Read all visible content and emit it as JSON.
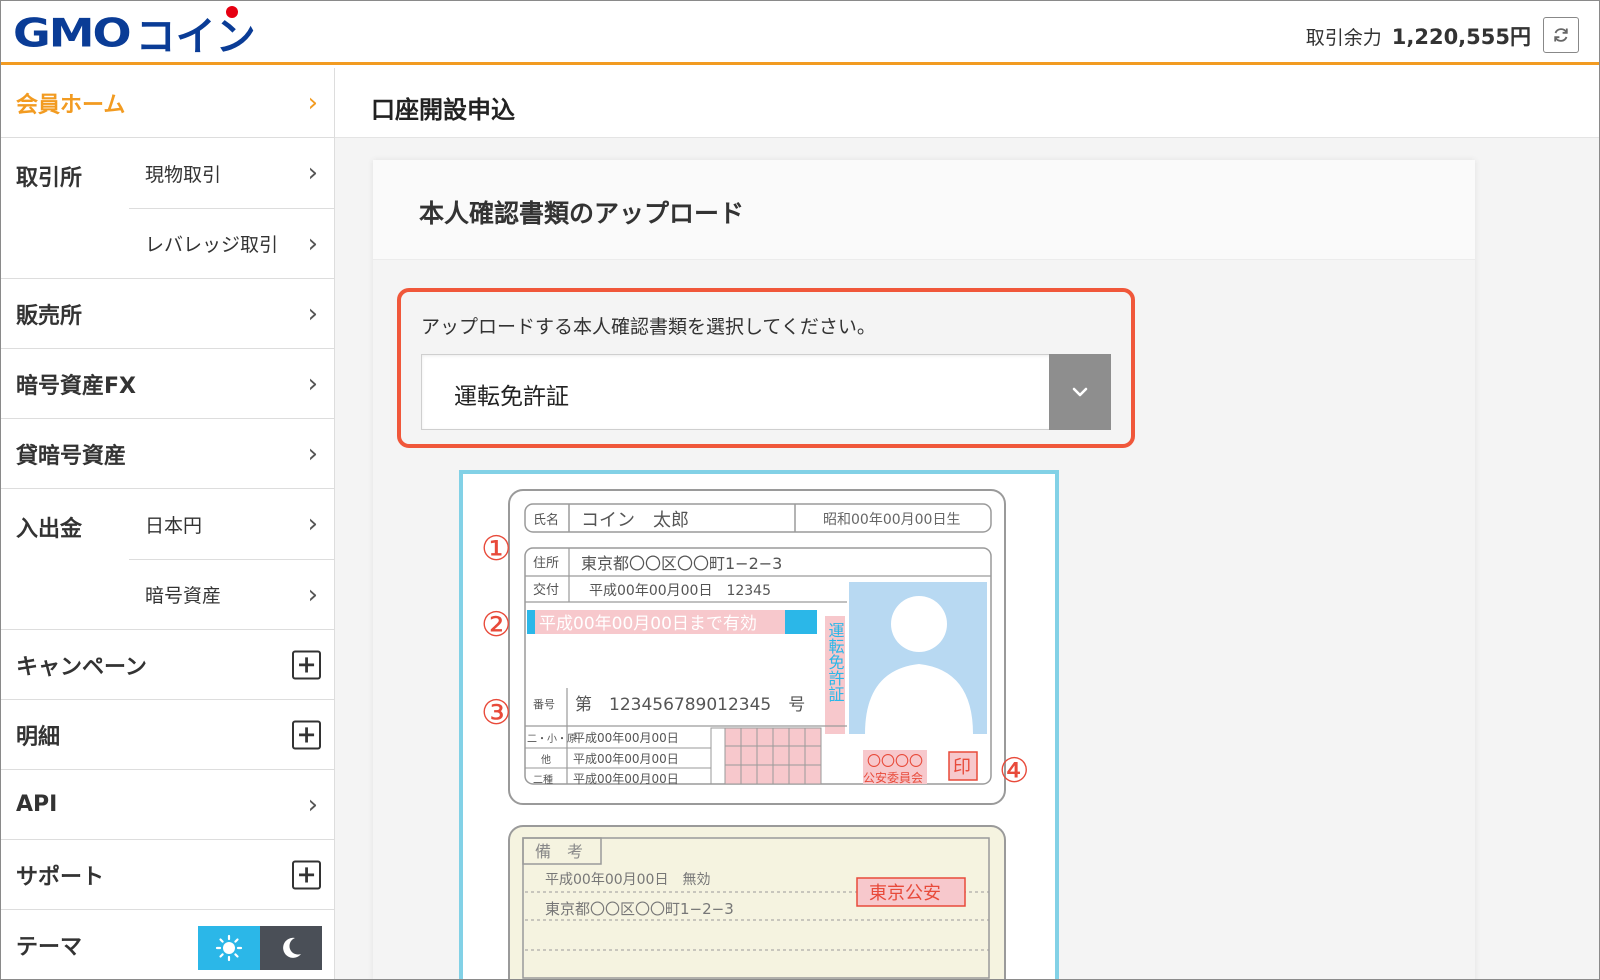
{
  "header": {
    "logo_latin": "GMO",
    "logo_kana": "コイン",
    "balance_label": "取引余力",
    "balance_value": "1,220,555円"
  },
  "sidebar": {
    "home": "会員ホーム",
    "exchange": {
      "title": "取引所",
      "items": [
        "現物取引",
        "レバレッジ取引"
      ]
    },
    "dealer": "販売所",
    "crypto_fx": "暗号資産FX",
    "lending": "貸暗号資産",
    "deposit": {
      "title": "入出金",
      "items": [
        "日本円",
        "暗号資産"
      ]
    },
    "campaign": "キャンペーン",
    "statement": "明細",
    "api": "API",
    "support": "サポート",
    "theme": "テーマ"
  },
  "main": {
    "page_title": "口座開設申込",
    "card_title": "本人確認書類のアップロード",
    "select_label": "アップロードする本人確認書類を選択してください。",
    "select_value": "運転免許証"
  },
  "license": {
    "name_label": "氏名",
    "name_value": "コイン　太郎",
    "birth": "昭和00年00月00日生",
    "address_label": "住所",
    "address_value": "東京都〇〇区〇〇町1−2−3",
    "issue_label": "交付",
    "issue_value": "平成00年00月00日　12345",
    "expiry": "平成00年00月00日まで有効",
    "vertical": "運転免許証",
    "number_label": "番号",
    "number_value": "第　123456789012345　号",
    "class_labels": [
      "二・小・原",
      "他",
      "二種"
    ],
    "class_dates": [
      "平成00年00月00日",
      "平成00年00月00日",
      "平成00年00月00日"
    ],
    "commission_line1": "〇〇〇〇",
    "commission_line2": "公安委員会",
    "seal": "印",
    "markers": [
      "①",
      "②",
      "③",
      "④"
    ],
    "remarks_label": "備　考",
    "remarks_line1": "平成00年00月00日　無効",
    "remarks_line2": "東京都〇〇区〇〇町1−2−3",
    "remarks_stamp": "東京公安"
  },
  "colors": {
    "accent": "#f29b21",
    "logo_blue": "#0a3c96",
    "highlight": "#f0573a",
    "frame_cyan": "#82d1e6",
    "photo_blue": "#b8d9f2",
    "mark_pink": "#f7c8cc"
  }
}
